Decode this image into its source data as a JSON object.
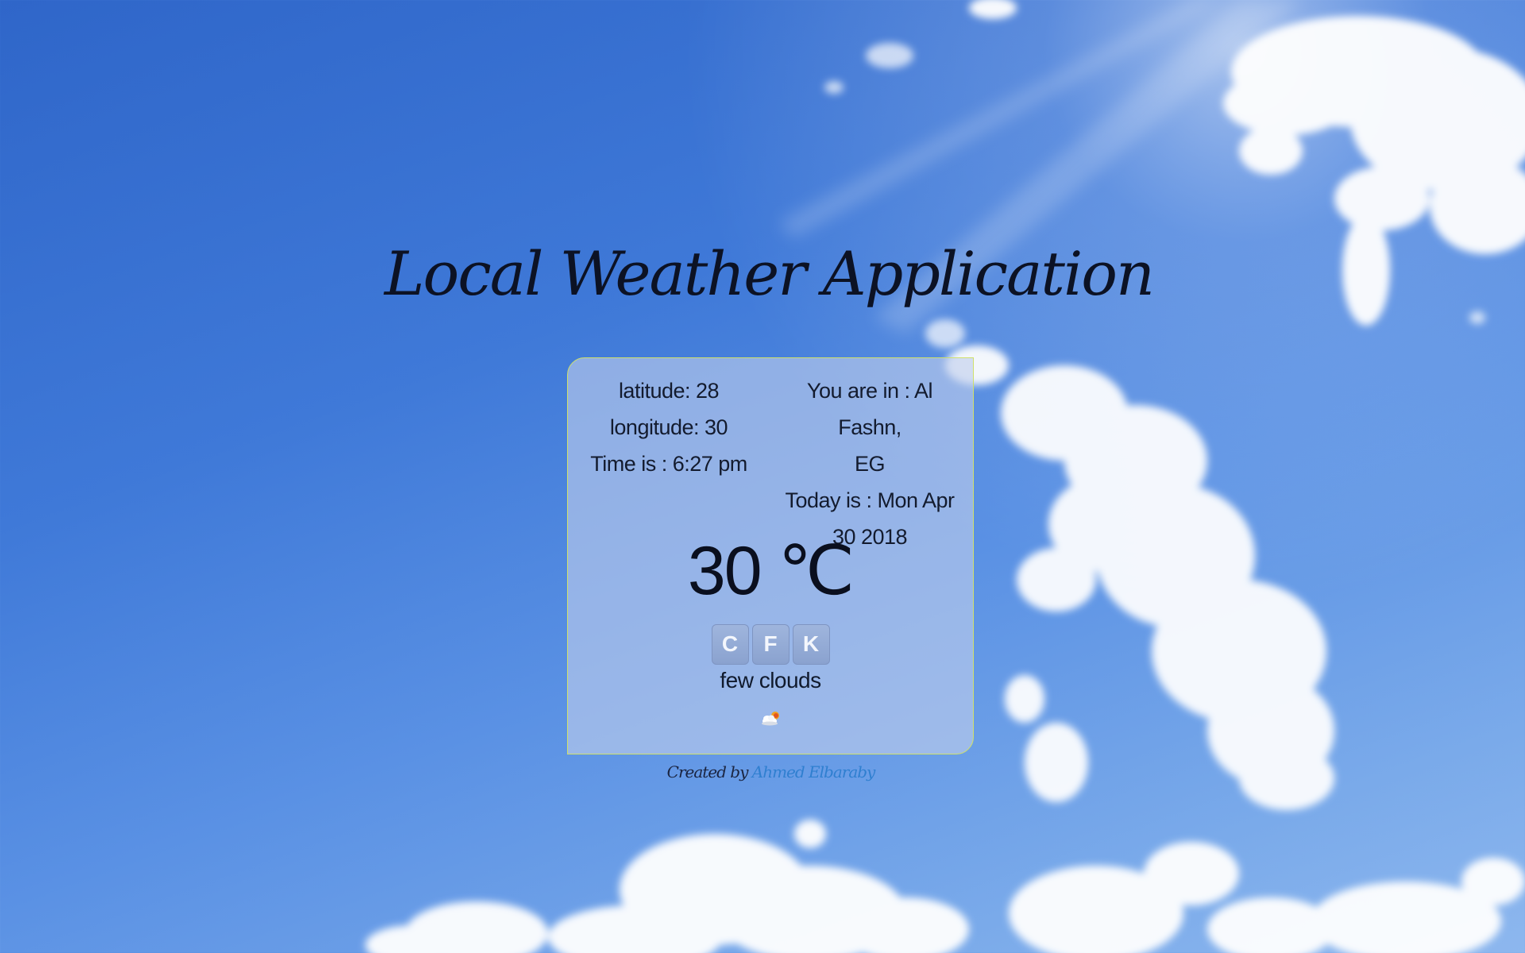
{
  "page": {
    "title": "Local Weather Application"
  },
  "card": {
    "latitude": "latitude: 28",
    "longitude": "longitude: 30",
    "time": "Time is : 6:27 pm",
    "location_line1": "You are in : Al Fashn,",
    "location_line2": "EG",
    "date_line1": "Today is : Mon Apr",
    "date_line2": "30 2018",
    "temperature": "30 ℃",
    "units": [
      "C",
      "F",
      "K"
    ],
    "description": "few clouds",
    "icon": "few-clouds-icon"
  },
  "footer": {
    "prefix": "Created by",
    "author": "Ahmed Elbaraby"
  },
  "colors": {
    "card_border": "#cfe06b",
    "title_text": "#0c1224",
    "author_link": "#2f7fd0"
  }
}
